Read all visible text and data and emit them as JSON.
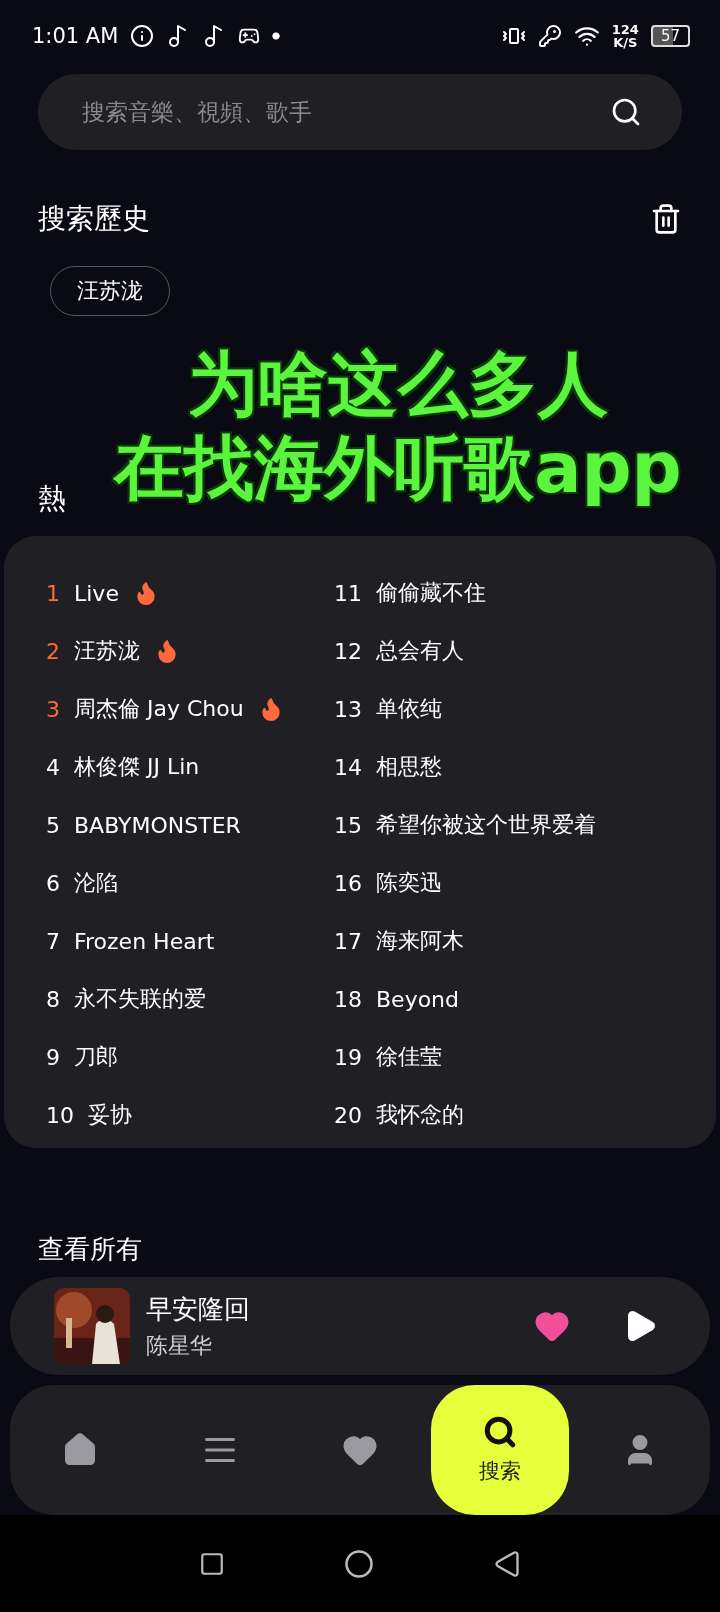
{
  "status_bar": {
    "time": "1:01 AM",
    "net_speed": "124",
    "net_unit": "K/S",
    "battery": "57"
  },
  "search": {
    "placeholder": "搜索音樂、視頻、歌手"
  },
  "history": {
    "title": "搜索歷史",
    "chips": [
      "汪苏泷"
    ]
  },
  "caption": {
    "lines": [
      "为啥这么多人",
      "在找海外听歌app"
    ]
  },
  "hot": {
    "title": "熱",
    "items": [
      {
        "rank": "1",
        "label": "Live",
        "hot": true
      },
      {
        "rank": "2",
        "label": "汪苏泷",
        "hot": true
      },
      {
        "rank": "3",
        "label": "周杰倫 Jay Chou",
        "hot": true
      },
      {
        "rank": "4",
        "label": "林俊傑 JJ Lin",
        "hot": false
      },
      {
        "rank": "5",
        "label": "BABYMONSTER",
        "hot": false
      },
      {
        "rank": "6",
        "label": "沦陷",
        "hot": false
      },
      {
        "rank": "7",
        "label": "Frozen Heart",
        "hot": false
      },
      {
        "rank": "8",
        "label": "永不失联的爱",
        "hot": false
      },
      {
        "rank": "9",
        "label": "刀郎",
        "hot": false
      },
      {
        "rank": "10",
        "label": "妥协",
        "hot": false
      },
      {
        "rank": "11",
        "label": "偷偷藏不住",
        "hot": false
      },
      {
        "rank": "12",
        "label": "总会有人",
        "hot": false
      },
      {
        "rank": "13",
        "label": "单依纯",
        "hot": false
      },
      {
        "rank": "14",
        "label": "相思愁",
        "hot": false
      },
      {
        "rank": "15",
        "label": "希望你被这个世界爱着",
        "hot": false
      },
      {
        "rank": "16",
        "label": "陈奕迅",
        "hot": false
      },
      {
        "rank": "17",
        "label": "海来阿木",
        "hot": false
      },
      {
        "rank": "18",
        "label": "Beyond",
        "hot": false
      },
      {
        "rank": "19",
        "label": "徐佳莹",
        "hot": false
      },
      {
        "rank": "20",
        "label": "我怀念的",
        "hot": false
      }
    ]
  },
  "see_all": "查看所有",
  "player": {
    "title": "早安隆回",
    "artist": "陈星华",
    "liked": true
  },
  "nav": [
    {
      "kind": "home",
      "selected": false
    },
    {
      "kind": "list",
      "selected": false
    },
    {
      "kind": "heart",
      "selected": false
    },
    {
      "kind": "search",
      "label": "搜索",
      "selected": true
    },
    {
      "kind": "user",
      "selected": false
    }
  ]
}
